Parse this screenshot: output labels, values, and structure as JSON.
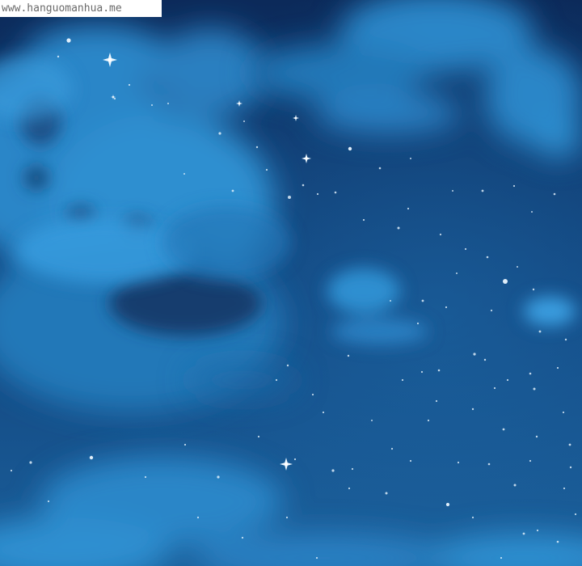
{
  "watermark": {
    "text": "www.hanguomanhua.me"
  },
  "scene": {
    "subject": "night-sky",
    "colors": {
      "sky_top": "#0c2a5a",
      "sky_mid": "#124680",
      "sky_bottom": "#1b5f9a",
      "cloud_light": "#3fa2e0",
      "cloud_mid": "#2a7fc0",
      "cloud_dark": "#123d6e",
      "star": "#eaf6ff"
    },
    "icons": [
      "star-icon",
      "sparkle-icon",
      "cloud-icon"
    ]
  }
}
